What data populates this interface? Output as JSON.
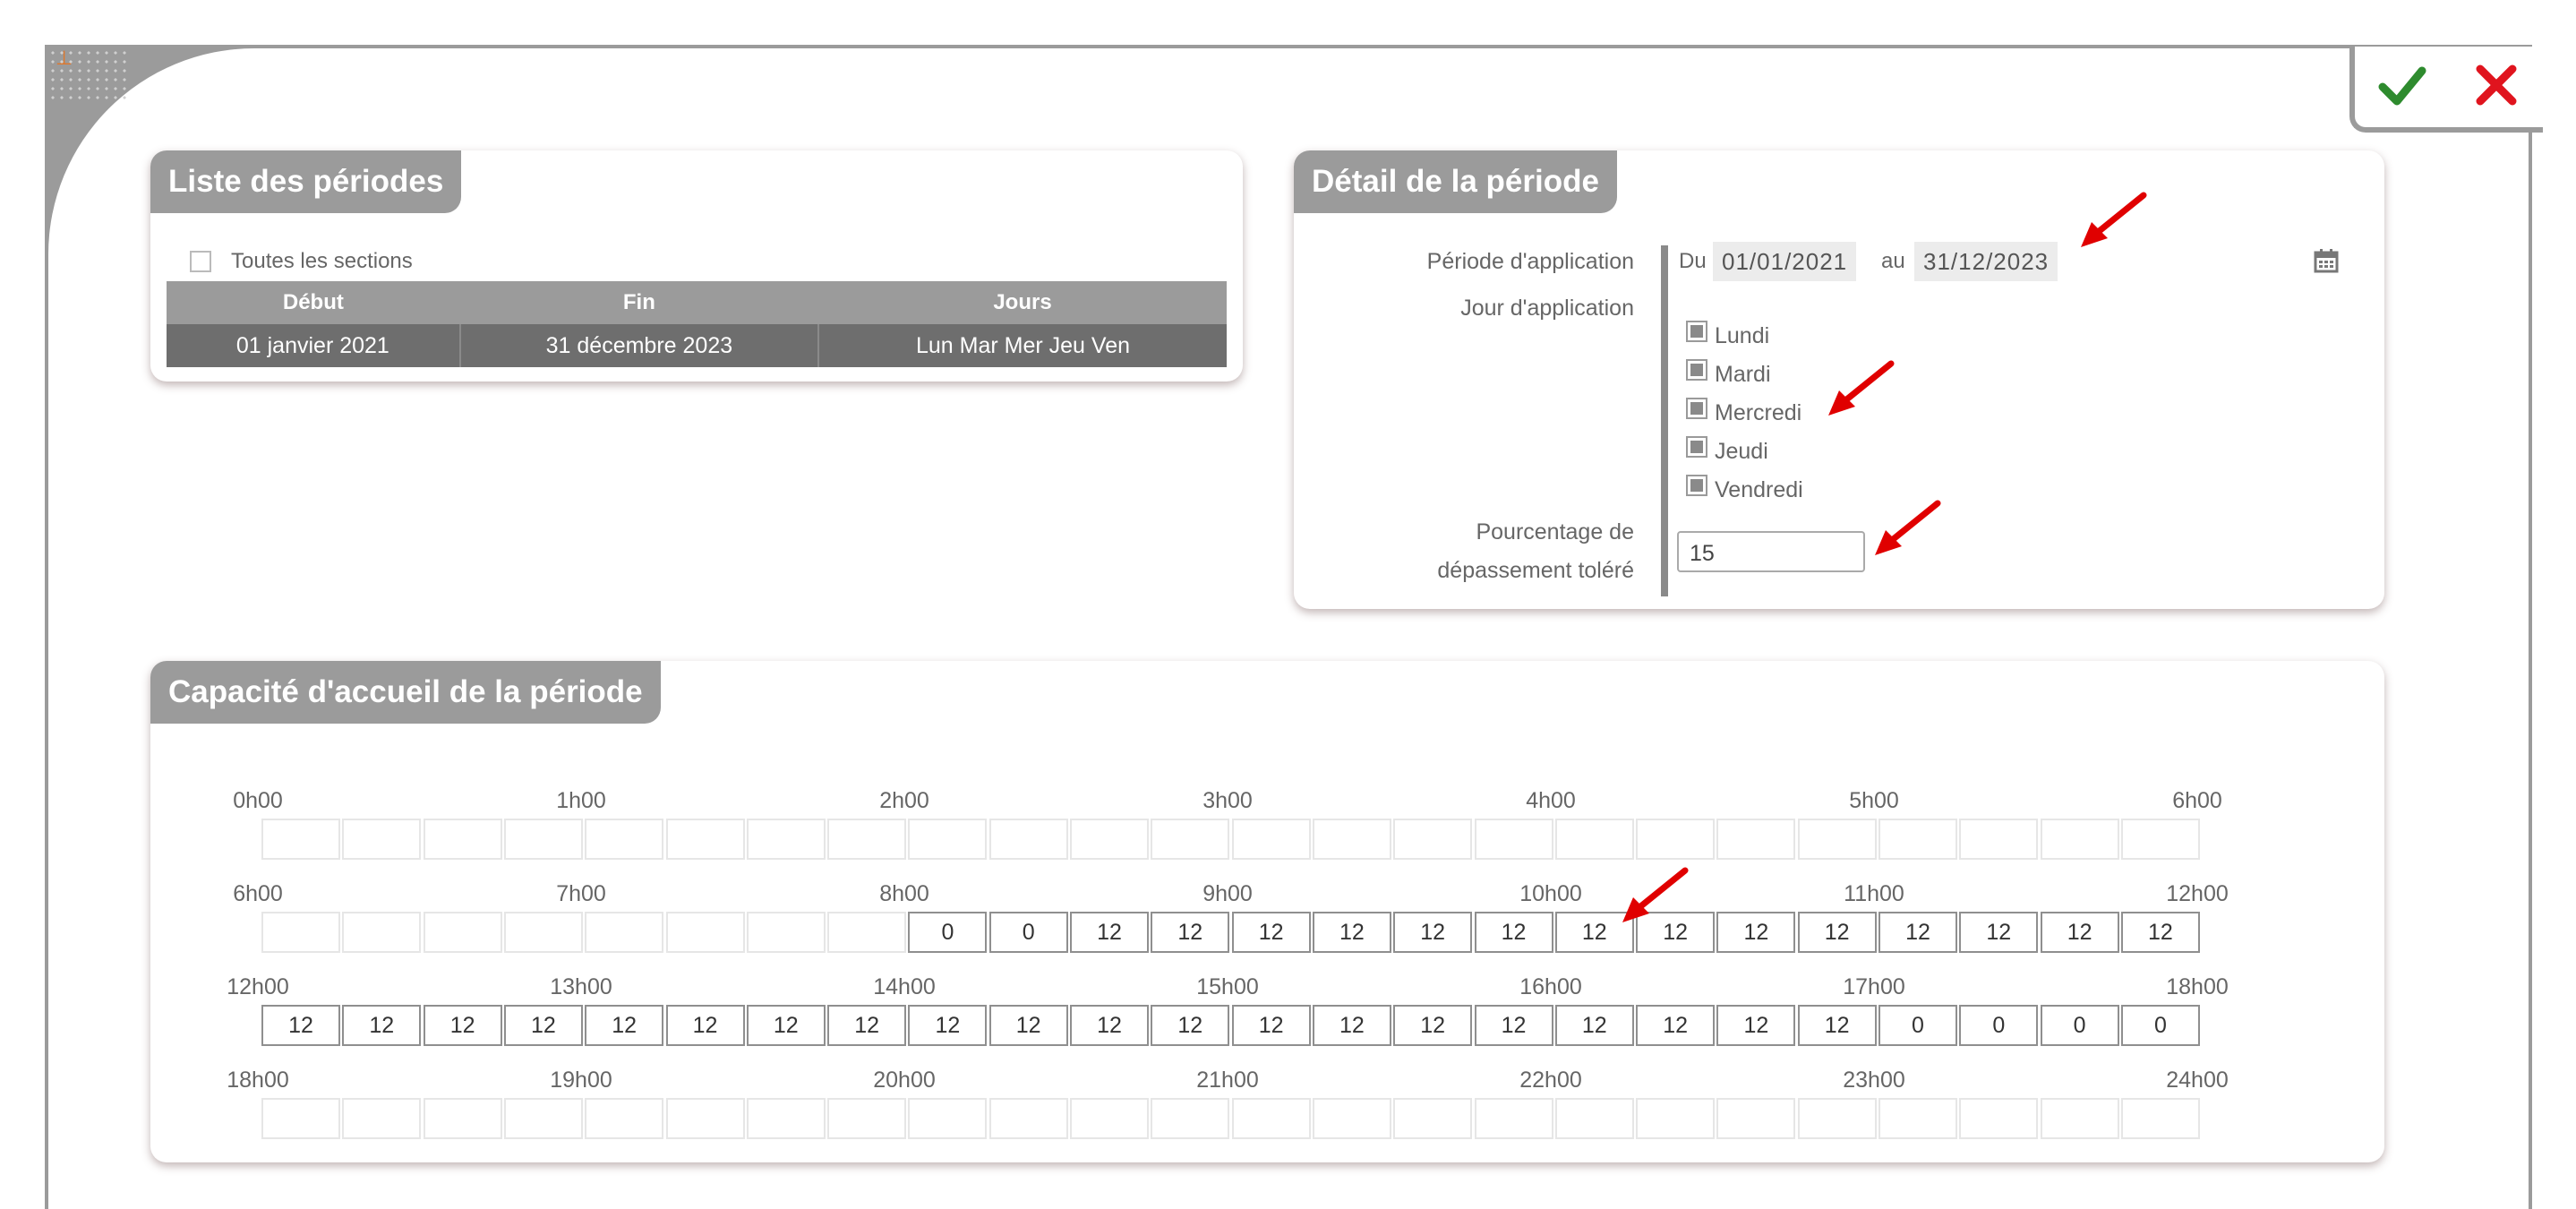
{
  "actions": {
    "confirm_icon": "check-icon",
    "cancel_icon": "close-icon",
    "confirm_color": "#2e8b2e",
    "cancel_color": "#e0141e"
  },
  "list_panel": {
    "title": "Liste des périodes",
    "all_sections_label": "Toutes les sections",
    "columns": [
      "Début",
      "Fin",
      "Jours"
    ],
    "rows": [
      [
        "01 janvier 2021",
        "31 décembre 2023",
        "Lun Mar Mer Jeu Ven"
      ]
    ]
  },
  "detail_panel": {
    "title": "Détail de la période",
    "period_label": "Période d'application",
    "from_label": "Du",
    "from_value": "01/01/2021",
    "to_label": "au",
    "to_value": "31/12/2023",
    "days_label": "Jour d'application",
    "days": [
      "Lundi",
      "Mardi",
      "Mercredi",
      "Jeudi",
      "Vendredi"
    ],
    "tolerance_label_line1": "Pourcentage de",
    "tolerance_label_line2": "dépassement toléré",
    "tolerance_value": "15"
  },
  "capacity_panel": {
    "title": "Capacité d'accueil de la période",
    "rows": [
      {
        "hours": [
          "0h00",
          "1h00",
          "2h00",
          "3h00",
          "4h00",
          "5h00",
          "6h00"
        ],
        "cells": [
          "",
          "",
          "",
          "",
          "",
          "",
          "",
          "",
          "",
          "",
          "",
          "",
          "",
          "",
          "",
          "",
          "",
          "",
          "",
          "",
          "",
          "",
          "",
          ""
        ]
      },
      {
        "hours": [
          "6h00",
          "7h00",
          "8h00",
          "9h00",
          "10h00",
          "11h00",
          "12h00"
        ],
        "cells": [
          "",
          "",
          "",
          "",
          "",
          "",
          "",
          "",
          "0",
          "0",
          "12",
          "12",
          "12",
          "12",
          "12",
          "12",
          "12",
          "12",
          "12",
          "12",
          "12",
          "12",
          "12",
          "12"
        ]
      },
      {
        "hours": [
          "12h00",
          "13h00",
          "14h00",
          "15h00",
          "16h00",
          "17h00",
          "18h00"
        ],
        "cells": [
          "12",
          "12",
          "12",
          "12",
          "12",
          "12",
          "12",
          "12",
          "12",
          "12",
          "12",
          "12",
          "12",
          "12",
          "12",
          "12",
          "12",
          "12",
          "12",
          "12",
          "0",
          "0",
          "0",
          "0"
        ]
      },
      {
        "hours": [
          "18h00",
          "19h00",
          "20h00",
          "21h00",
          "22h00",
          "23h00",
          "24h00"
        ],
        "cells": [
          "",
          "",
          "",
          "",
          "",
          "",
          "",
          "",
          "",
          "",
          "",
          "",
          "",
          "",
          "",
          "",
          "",
          "",
          "",
          "",
          "",
          "",
          "",
          ""
        ]
      }
    ]
  },
  "annotations": {
    "arrow_color": "#e00000"
  }
}
